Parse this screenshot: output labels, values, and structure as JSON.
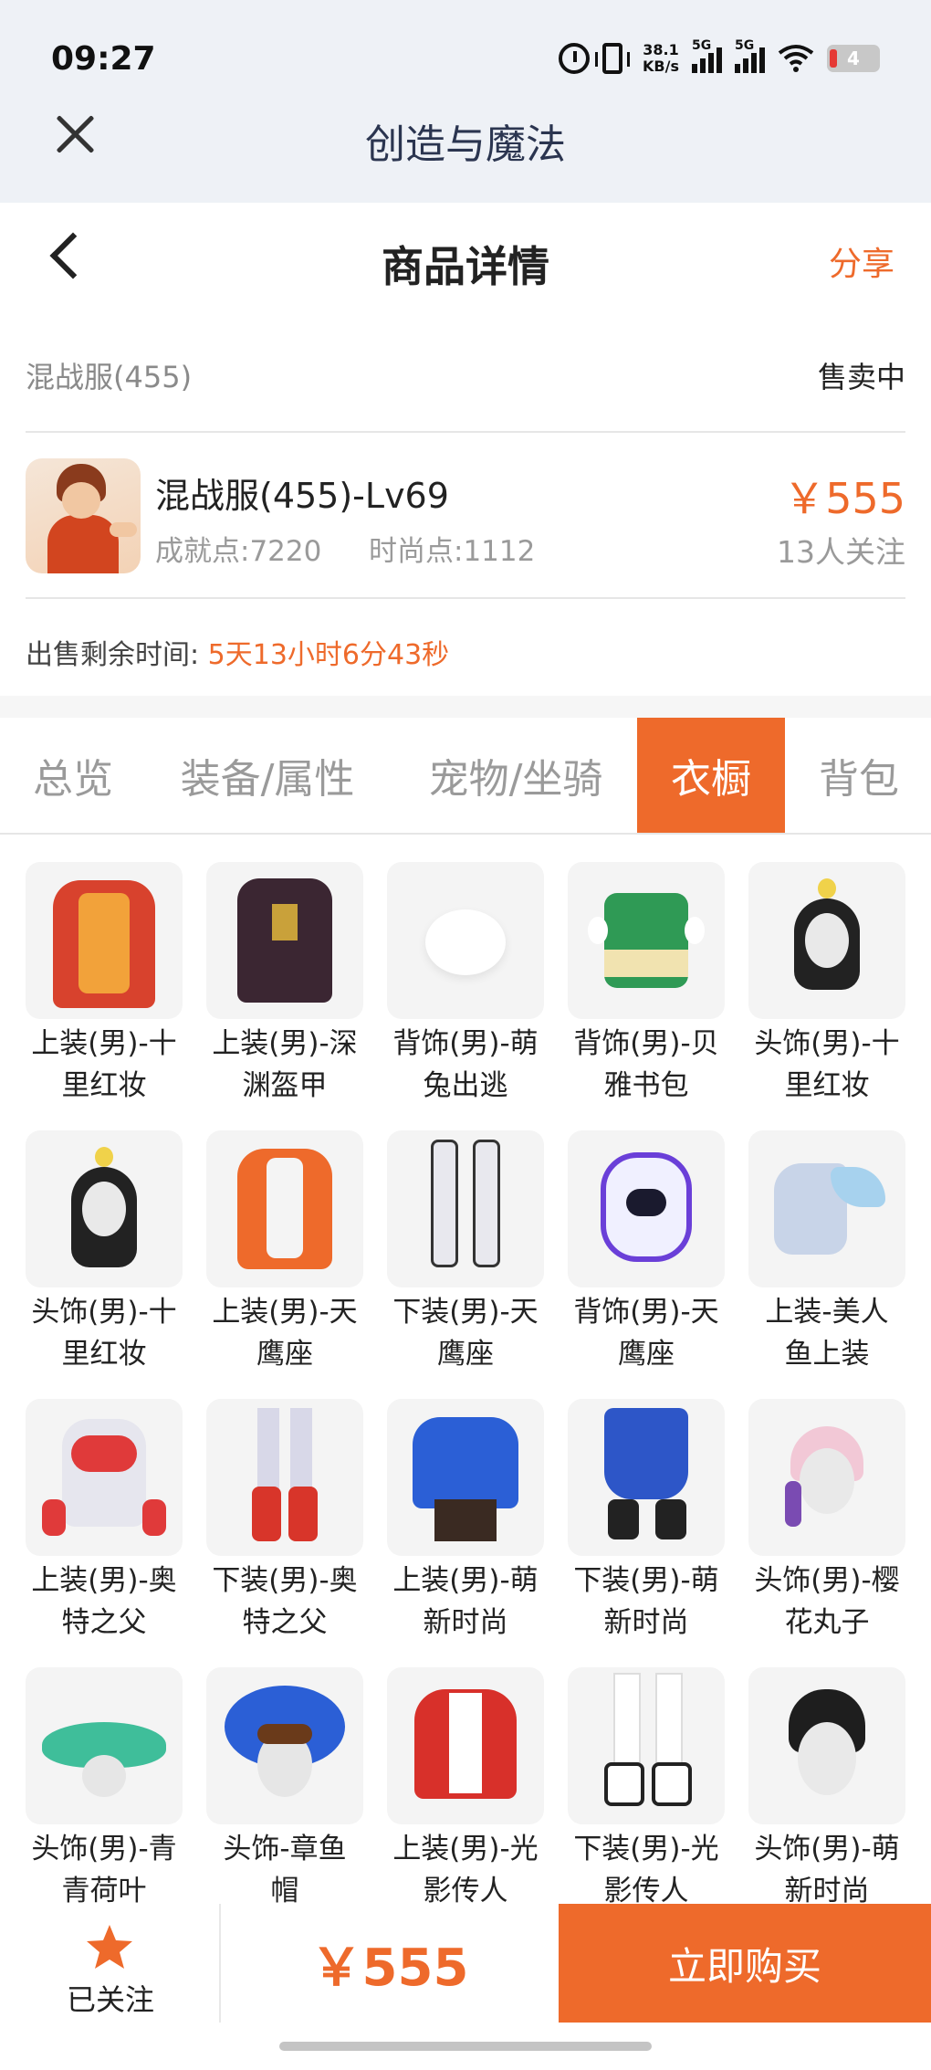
{
  "status_bar": {
    "time": "09:27",
    "net_speed_value": "38.1",
    "net_speed_unit": "KB/s",
    "sim1_label": "5G",
    "sim2_label": "5G",
    "battery": "4",
    "icons": [
      "alarm-icon",
      "vibrate-icon",
      "signal-icon",
      "signal-icon",
      "wifi-icon",
      "battery-icon"
    ]
  },
  "app_bar": {
    "title": "创造与魔法"
  },
  "header": {
    "title": "商品详情",
    "share_label": "分享"
  },
  "product": {
    "server": "混战服(455)",
    "status": "售卖中",
    "character_name": "混战服(455)-Lv69",
    "achievement": "成就点:7220",
    "fashion": "时尚点:1112",
    "price": "￥555",
    "followers": "13人关注",
    "time_label": "出售剩余时间:",
    "time_value": "5天13小时6分43秒"
  },
  "tabs": [
    {
      "label": "总览",
      "active": false
    },
    {
      "label": "装备/属性",
      "active": false
    },
    {
      "label": "宠物/坐骑",
      "active": false
    },
    {
      "label": "衣橱",
      "active": true
    },
    {
      "label": "背包",
      "active": false
    }
  ],
  "wardrobe": [
    {
      "line1": "上装(男)-十",
      "line2": "里红妆"
    },
    {
      "line1": "上装(男)-深",
      "line2": "渊盔甲"
    },
    {
      "line1": "背饰(男)-萌",
      "line2": "兔出逃"
    },
    {
      "line1": "背饰(男)-贝",
      "line2": "雅书包"
    },
    {
      "line1": "头饰(男)-十",
      "line2": "里红妆"
    },
    {
      "line1": "头饰(男)-十",
      "line2": "里红妆"
    },
    {
      "line1": "上装(男)-天",
      "line2": "鹰座"
    },
    {
      "line1": "下装(男)-天",
      "line2": "鹰座"
    },
    {
      "line1": "背饰(男)-天",
      "line2": "鹰座"
    },
    {
      "line1": "上装-美人",
      "line2": "鱼上装"
    },
    {
      "line1": "上装(男)-奥",
      "line2": "特之父"
    },
    {
      "line1": "下装(男)-奥",
      "line2": "特之父"
    },
    {
      "line1": "上装(男)-萌",
      "line2": "新时尚"
    },
    {
      "line1": "下装(男)-萌",
      "line2": "新时尚"
    },
    {
      "line1": "头饰(男)-樱",
      "line2": "花丸子"
    },
    {
      "line1": "头饰(男)-青",
      "line2": "青荷叶"
    },
    {
      "line1": "头饰-章鱼",
      "line2": "帽"
    },
    {
      "line1": "上装(男)-光",
      "line2": "影传人"
    },
    {
      "line1": "下装(男)-光",
      "line2": "影传人"
    },
    {
      "line1": "头饰(男)-萌",
      "line2": "新时尚"
    }
  ],
  "bottom_bar": {
    "follow_label": "已关注",
    "price": "￥555",
    "buy_label": "立即购买"
  },
  "colors": {
    "accent": "#ee6a2b",
    "top_bg": "#eef1f6",
    "muted_text": "#9a9a9a"
  }
}
